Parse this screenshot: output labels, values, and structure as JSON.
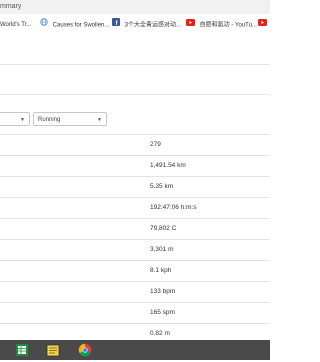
{
  "window": {
    "title_fragment": "mmary"
  },
  "bookmarks": [
    {
      "label": "World's Tr...",
      "icon": "globe-icon"
    },
    {
      "label": "Causes for Swollen...",
      "icon": "globe-icon"
    },
    {
      "label": "3个大全青运感对动...",
      "icon": "facebook-icon"
    },
    {
      "label": "自愿和氣功 - YouTu...",
      "icon": "youtube-icon"
    },
    {
      "label": "",
      "icon": "youtube-icon"
    }
  ],
  "filters": {
    "first_select_value": "",
    "activity_select_value": "Running"
  },
  "stats": [
    "279",
    "1,491.54 km",
    "5.35 km",
    "192:47:06 h:m:s",
    "79,802 C",
    "3,301 m",
    "8.1 kph",
    "133 bpm",
    "165 spm",
    "0.82 m"
  ],
  "taskbar": {
    "icons": [
      "spreadsheet-icon",
      "notes-icon",
      "chrome-icon"
    ]
  },
  "colors": {
    "youtube_red": "#e62117",
    "facebook_blue": "#3b5998",
    "taskbar_bg": "#4a4a4a"
  }
}
